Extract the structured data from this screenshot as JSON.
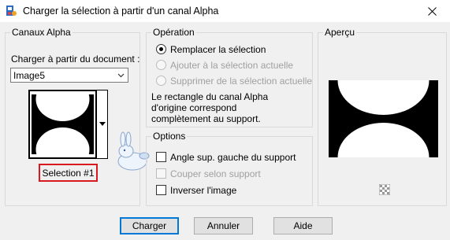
{
  "window": {
    "title": "Charger la sélection à partir d'un canal Alpha"
  },
  "canaux": {
    "legend": "Canaux Alpha",
    "load_from_label": "Charger à partir du document :",
    "document_value": "Image5",
    "selection_label": "Selection #1"
  },
  "operation": {
    "legend": "Opération",
    "options": [
      {
        "label": "Remplacer la sélection",
        "selected": true,
        "enabled": true
      },
      {
        "label": "Ajouter à la sélection actuelle",
        "selected": false,
        "enabled": false
      },
      {
        "label": "Supprimer de la sélection actuelle",
        "selected": false,
        "enabled": false
      }
    ],
    "info_line1": "Le rectangle du canal Alpha",
    "info_line2": "d'origine correspond",
    "info_line3": "complètement au support."
  },
  "options": {
    "legend": "Options",
    "items": [
      {
        "label": "Angle sup. gauche du support",
        "checked": false,
        "enabled": true
      },
      {
        "label": "Couper selon support",
        "checked": false,
        "enabled": false
      },
      {
        "label": "Inverser l'image",
        "checked": false,
        "enabled": true
      }
    ]
  },
  "apercu": {
    "legend": "Aperçu"
  },
  "buttons": {
    "load": "Charger",
    "cancel": "Annuler",
    "help": "Aide"
  },
  "colors": {
    "highlight_box": "#d8191f",
    "default_button_border": "#0078d7"
  }
}
